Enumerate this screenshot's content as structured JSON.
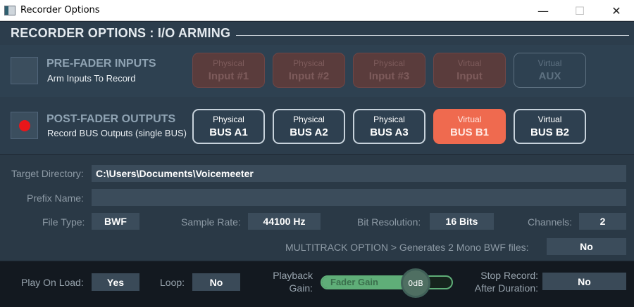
{
  "window": {
    "title": "Recorder Options",
    "minimize_glyph": "—",
    "maximize_glyph": "☐",
    "close_glyph": "✕"
  },
  "header": {
    "title": "RECORDER OPTIONS : I/O ARMING"
  },
  "pre_fader": {
    "title": "PRE-FADER INPUTS",
    "subtitle": "Arm Inputs To Record",
    "armed": false,
    "buttons": [
      {
        "line1": "Physical",
        "line2": "Input #1"
      },
      {
        "line1": "Physical",
        "line2": "Input #2"
      },
      {
        "line1": "Physical",
        "line2": "Input #3"
      },
      {
        "line1": "Virtual",
        "line2": "Input"
      },
      {
        "line1": "Virtual",
        "line2": "AUX"
      }
    ]
  },
  "post_fader": {
    "title": "POST-FADER OUTPUTS",
    "subtitle": "Record BUS Outputs (single BUS)",
    "armed": true,
    "buttons": [
      {
        "line1": "Physical",
        "line2": "BUS A1",
        "active": false
      },
      {
        "line1": "Physical",
        "line2": "BUS A2",
        "active": false
      },
      {
        "line1": "Physical",
        "line2": "BUS A3",
        "active": false
      },
      {
        "line1": "Virtual",
        "line2": "BUS B1",
        "active": true
      },
      {
        "line1": "Virtual",
        "line2": "BUS B2",
        "active": false
      }
    ]
  },
  "settings": {
    "target_dir_label": "Target Directory:",
    "target_dir_value": "C:\\Users\\Documents\\Voicemeeter",
    "prefix_label": "Prefix Name:",
    "prefix_value": "",
    "file_type_label": "File Type:",
    "file_type_value": "BWF",
    "sample_rate_label": "Sample Rate:",
    "sample_rate_value": "44100 Hz",
    "bit_res_label": "Bit Resolution:",
    "bit_res_value": "16 Bits",
    "channels_label": "Channels:",
    "channels_value": "2",
    "multitrack_label": "MULTITRACK OPTION > Generates 2 Mono BWF files:",
    "multitrack_value": "No"
  },
  "playback": {
    "play_on_load_label": "Play On Load:",
    "play_on_load_value": "Yes",
    "loop_label": "Loop:",
    "loop_value": "No",
    "gain_label_1": "Playback",
    "gain_label_2": "Gain:",
    "fader_label": "Fader Gain",
    "fader_value": "0dB",
    "stop_label_1": "Stop Record:",
    "stop_label_2": "After Duration:",
    "stop_value": "No"
  },
  "colors": {
    "active_bus": "#ef6a4f",
    "armed_dot": "#e8161a",
    "fader_green": "#5fae78"
  }
}
